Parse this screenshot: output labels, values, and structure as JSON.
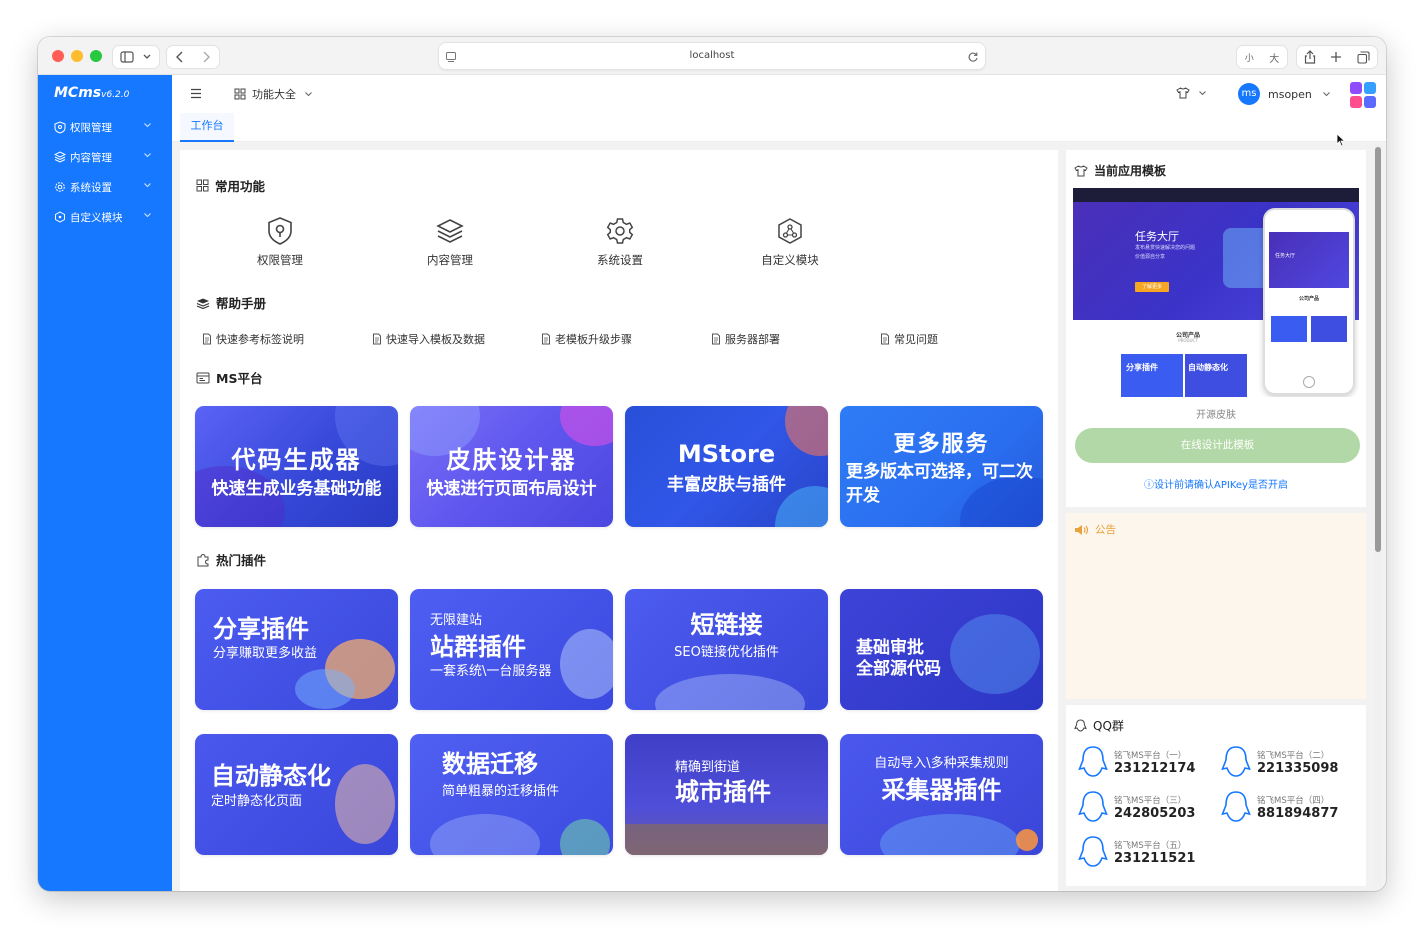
{
  "browser": {
    "url": "localhost",
    "font_small": "小",
    "font_large": "大"
  },
  "app": {
    "logo": "MCms",
    "version": "v6.2.0"
  },
  "sidebar": {
    "items": [
      {
        "label": "权限管理"
      },
      {
        "label": "内容管理"
      },
      {
        "label": "系统设置"
      },
      {
        "label": "自定义模块"
      }
    ]
  },
  "topbar": {
    "menu_label": "功能大全",
    "user_initials": "ms",
    "username": "msopen"
  },
  "tabs": [
    {
      "label": "工作台"
    }
  ],
  "common": {
    "title": "常用功能",
    "items": [
      {
        "label": "权限管理"
      },
      {
        "label": "内容管理"
      },
      {
        "label": "系统设置"
      },
      {
        "label": "自定义模块"
      }
    ]
  },
  "help": {
    "title": "帮助手册",
    "items": [
      {
        "label": "快速参考标签说明"
      },
      {
        "label": "快速导入模板及数据"
      },
      {
        "label": "老模板升级步骤"
      },
      {
        "label": "服务器部署"
      },
      {
        "label": "常见问题"
      }
    ]
  },
  "platform": {
    "title": "MS平台",
    "cards": [
      {
        "title": "代码生成器",
        "subtitle": "快速生成业务基础功能"
      },
      {
        "title": "皮肤设计器",
        "subtitle": "快速进行页面布局设计"
      },
      {
        "title": "MStore",
        "subtitle": "丰富皮肤与插件"
      },
      {
        "title": "更多服务",
        "subtitle": "更多版本可选择，可二次开发"
      }
    ]
  },
  "plugins": {
    "title": "热门插件",
    "cards": [
      {
        "title": "分享插件",
        "subtitle": "分享赚取更多收益",
        "pre": ""
      },
      {
        "title": "站群插件",
        "subtitle": "一套系统\\一台服务器",
        "pre": "无限建站"
      },
      {
        "title": "短链接",
        "subtitle": "SEO链接优化插件",
        "pre": ""
      },
      {
        "title": "基础审批",
        "subtitle": "全部源代码",
        "pre": ""
      },
      {
        "title": "自动静态化",
        "subtitle": "定时静态化页面",
        "pre": ""
      },
      {
        "title": "数据迁移",
        "subtitle": "简单粗暴的迁移插件",
        "pre": ""
      },
      {
        "title": "城市插件",
        "subtitle": "",
        "pre": "精确到街道"
      },
      {
        "title": "采集器插件",
        "subtitle": "",
        "pre": "自动导入\\多种采集规则"
      }
    ]
  },
  "template": {
    "title": "当前应用模板",
    "preview": {
      "hero": "任务大厅",
      "hero_sub": "发布悬赏快速解决您的问题",
      "hero_sub2": "价值源自分享",
      "button": "了解更多",
      "section": "公司产品",
      "section_en": "PRODUCT",
      "tile1": "分享插件",
      "tile2": "自动静态化",
      "phone_title": "任务大厅",
      "phone_section": "公司产品"
    },
    "name": "开源皮肤",
    "design_button": "在线设计此模板",
    "hint": "设计前请确认APIKey是否开启"
  },
  "notice": {
    "title": "公告"
  },
  "qq": {
    "title": "QQ群",
    "groups": [
      {
        "label": "铭飞MS平台（一）",
        "number": "231212174"
      },
      {
        "label": "铭飞MS平台（二）",
        "number": "221335098"
      },
      {
        "label": "铭飞MS平台（三）",
        "number": "242805203"
      },
      {
        "label": "铭飞MS平台（四）",
        "number": "881894877"
      },
      {
        "label": "铭飞MS平台（五）",
        "number": "231211521"
      }
    ]
  },
  "colors": {
    "primary": "#1677ff",
    "button_bg": "#b3d8a7",
    "notice_bg": "#fdf6ec",
    "notice_accent": "#e6a23c"
  }
}
